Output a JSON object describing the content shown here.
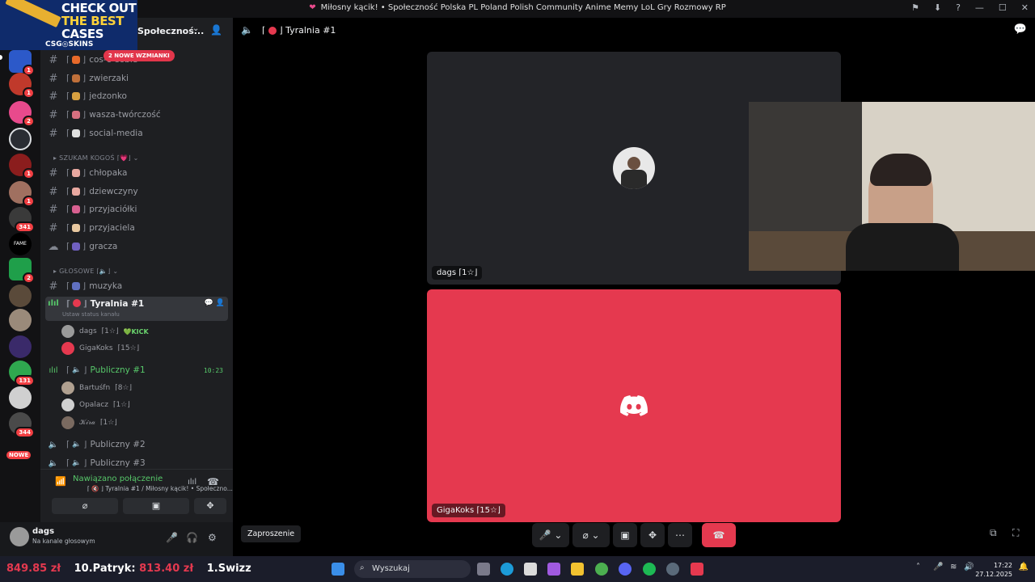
{
  "titlebar": {
    "title": "Miłosny kącik! • Społeczność Polska PL Poland Polish Community Anime Memy LoL Gry Rozmowy RP"
  },
  "promo": {
    "line1": "CHECK OUT",
    "line2": "THE BEST",
    "line3": "CASES",
    "brand": "CSG◎SKINS"
  },
  "guilds": {
    "badges": [
      "1",
      "1",
      "2",
      "1",
      "1",
      "341",
      "2",
      "131",
      "344",
      "NOWE"
    ]
  },
  "server": {
    "name": "Społecznoś...",
    "mention_pill": "2 NOWE WZMIANKI"
  },
  "channels": {
    "text": [
      {
        "label": "cos-o-sobie"
      },
      {
        "label": "zwierzaki"
      },
      {
        "label": "jedzonko"
      },
      {
        "label": "wasza-twórczość"
      },
      {
        "label": "social-media"
      }
    ],
    "category_seeking": "SZUKAM KOGOŚ",
    "seeking": [
      {
        "label": "chłopaka"
      },
      {
        "label": "dziewczyny"
      },
      {
        "label": "przyjaciółki"
      },
      {
        "label": "przyjaciela"
      },
      {
        "label": "gracza"
      }
    ],
    "category_voice": "GŁOSOWE",
    "music": "muzyka",
    "active_channel": "Tyralnia #1",
    "active_status": "Ustaw status kanału",
    "active_users": [
      {
        "name": "dags",
        "rank": "⌈1☆⌋",
        "tag": "KICK"
      },
      {
        "name": "GigaKoks",
        "rank": "⌈15☆⌋"
      }
    ],
    "public1": "Publiczny #1",
    "public1_time": "10:23",
    "public1_users": [
      {
        "name": "Bartuśfn",
        "rank": "⌈8☆⌋"
      },
      {
        "name": "Opalacz",
        "rank": "⌈1☆⌋"
      },
      {
        "name": "𝒦𝒾𝓇𝒶",
        "rank": "⌈1☆⌋"
      }
    ],
    "public2": "Publiczny #2",
    "public3": "Publiczny #3"
  },
  "voice_panel": {
    "status": "Nawiązano połączenie",
    "sub": "⌈ 🔇 ⌋ Tyralnia #1 / Miłosny kącik! • Społeczno..."
  },
  "user_panel": {
    "name": "dags",
    "status": "Na kanale głosowym"
  },
  "main": {
    "channel_title": "Tyralnia #1",
    "tile1_name": "dags ⌈1☆⌋",
    "tile2_name": "GigaKoks ⌈15☆⌋",
    "invite": "Zaproszenie"
  },
  "taskbar": {
    "ticker_1_value": "849.85 zł",
    "ticker_2_label": "10.Patryk:",
    "ticker_2_value": "813.40 zł",
    "ticker_3_label": "1.Swizz",
    "search_placeholder": "Wyszukaj",
    "time": "17:22",
    "date": "27.12.2025"
  },
  "colors": {
    "accent_red": "#e5394f",
    "connected_green": "#57c86a",
    "mention_red": "#e2364b"
  }
}
